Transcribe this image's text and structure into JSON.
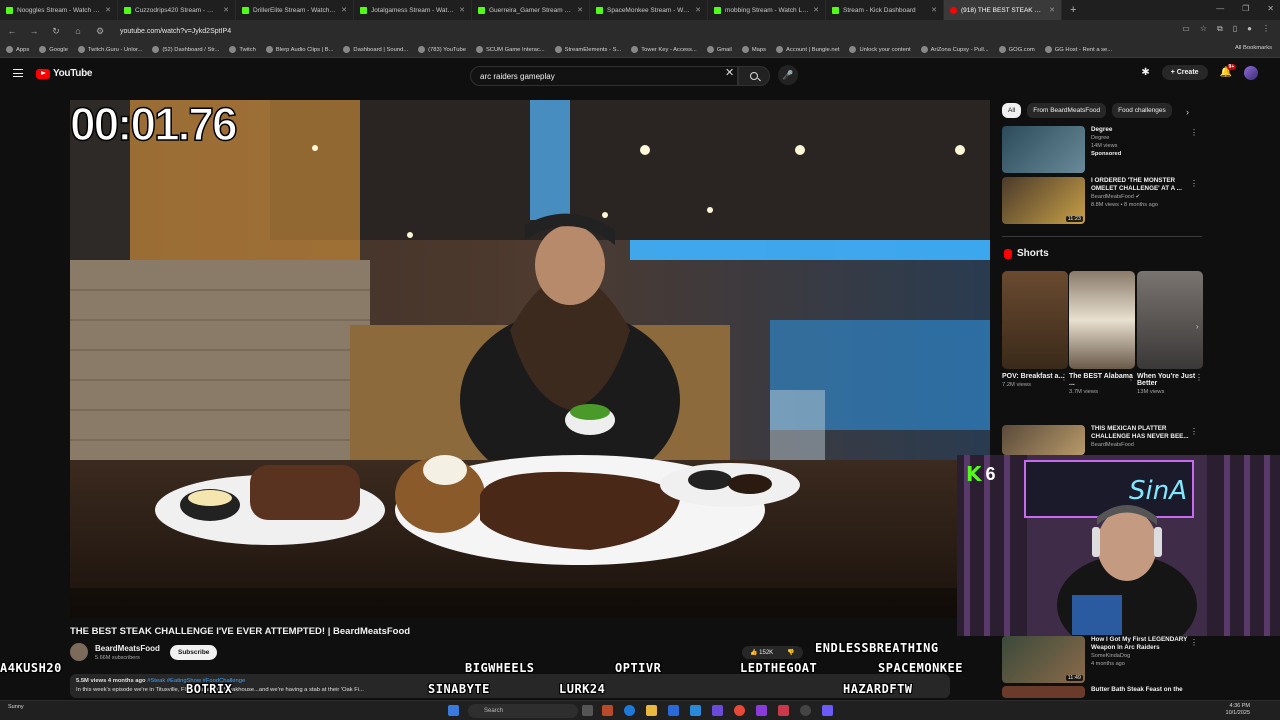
{
  "browser": {
    "tabs": [
      {
        "title": "Nooggles Stream - Watch Live",
        "active": false
      },
      {
        "title": "Cuzzodrips420 Stream - Watch",
        "active": false
      },
      {
        "title": "DrillerElite Stream - Watch Live",
        "active": false
      },
      {
        "title": "Jotalgamess Stream - Watch Li...",
        "active": false
      },
      {
        "title": "Guerreira_Gamer Stream - Wat...",
        "active": false
      },
      {
        "title": "SpaceMonkee Stream - Watch",
        "active": false
      },
      {
        "title": "mobbing Stream - Watch Live",
        "active": false
      },
      {
        "title": "Stream - Kick Dashboard",
        "active": false
      },
      {
        "title": "(918) THE BEST STEAK CHA...",
        "active": true
      }
    ],
    "url": "youtube.com/watch?v=Jykd2SptIP4",
    "bookmarks": [
      "Apps",
      "Google",
      "Twitch.Guru - Unlor...",
      "(52) Dashboard / Str...",
      "Twitch",
      "Blerp Audio Clips | B...",
      "Dashboard | Sound...",
      "(783) YouTube",
      "SCUM Game Interac...",
      "StreamElements - S...",
      "Tower Key - Access...",
      "Gmail",
      "Maps",
      "Account | Bungie.net",
      "Unlock your content",
      "AriZona Cupsy - Pull...",
      "GOG.com",
      "GG Host - Rent a se..."
    ],
    "all_bookmarks": "All Bookmarks"
  },
  "youtube": {
    "logo": "YouTube",
    "search_query": "arc raiders gameplay",
    "create_label": "Create",
    "notifications": "9+"
  },
  "video": {
    "timer_overlay": "00:01.76",
    "title": "THE BEST STEAK CHALLENGE I'VE EVER ATTEMPTED! | BeardMeatsFood",
    "channel": "BeardMeatsFood",
    "subscribers": "5.66M subscribers",
    "subscribe_label": "Subscribe",
    "likes": "152K",
    "views_date": "5.5M views  4 months ago",
    "hashtags": "#Steak #EatingShow #FoodChallenge",
    "description": "In this week's episode we're in Titusville, FL at Durango's Steakhouse...and we're having a stab at their 'Oak Fi..."
  },
  "sidebar": {
    "chips": [
      "All",
      "From BeardMeatsFood",
      "Food challenges"
    ],
    "recommendations": [
      {
        "title": "Degree",
        "channel": "Degree",
        "meta": "14M views",
        "badge": "Sponsored",
        "duration": ""
      },
      {
        "title": "I ORDERED 'THE MONSTER OMELET CHALLENGE' AT A ...",
        "channel": "BeardMeatsFood",
        "meta": "8.8M views • 8 months ago",
        "badge": "",
        "duration": "11:23"
      },
      {
        "title": "THIS MEXICAN PLATTER CHALLENGE HAS NEVER BEE...",
        "channel": "BeardMeatsFood",
        "meta": "",
        "badge": "",
        "duration": ""
      },
      {
        "title": "How I Got My First LEGENDARY Weapon In Arc Raiders",
        "channel": "SomeKindaDog",
        "meta": "4 months ago",
        "badge": "",
        "duration": "11:49"
      },
      {
        "title": "Butter Bath Steak Feast on the",
        "channel": "",
        "meta": "",
        "badge": "",
        "duration": ""
      }
    ],
    "shorts_label": "Shorts",
    "shorts": [
      {
        "title": "POV: Breakfast a...",
        "views": "7.2M views"
      },
      {
        "title": "The BEST Alabama ...",
        "views": "3.7M views"
      },
      {
        "title": "When You're Just Better",
        "views": "13M views"
      }
    ]
  },
  "overlay": {
    "kick_count": "6",
    "neon_sign": "SinA",
    "chatters": [
      "A4KUSH20",
      "BIGWHEELS",
      "OPTIVR",
      "LEDTHEGOAT",
      "SPACEMONKEE",
      "ENDLESSBREATHING",
      "BOTRIX",
      "SINABYTE",
      "LURK24",
      "HAZARDFTW"
    ]
  },
  "taskbar": {
    "search_label": "Search",
    "time": "4:36 PM",
    "date": "10/1/2025",
    "weather": "Sunny"
  },
  "colors": {
    "yt_red": "#ff0000",
    "kick_green": "#53fc18",
    "bg": "#0f0f0f"
  }
}
